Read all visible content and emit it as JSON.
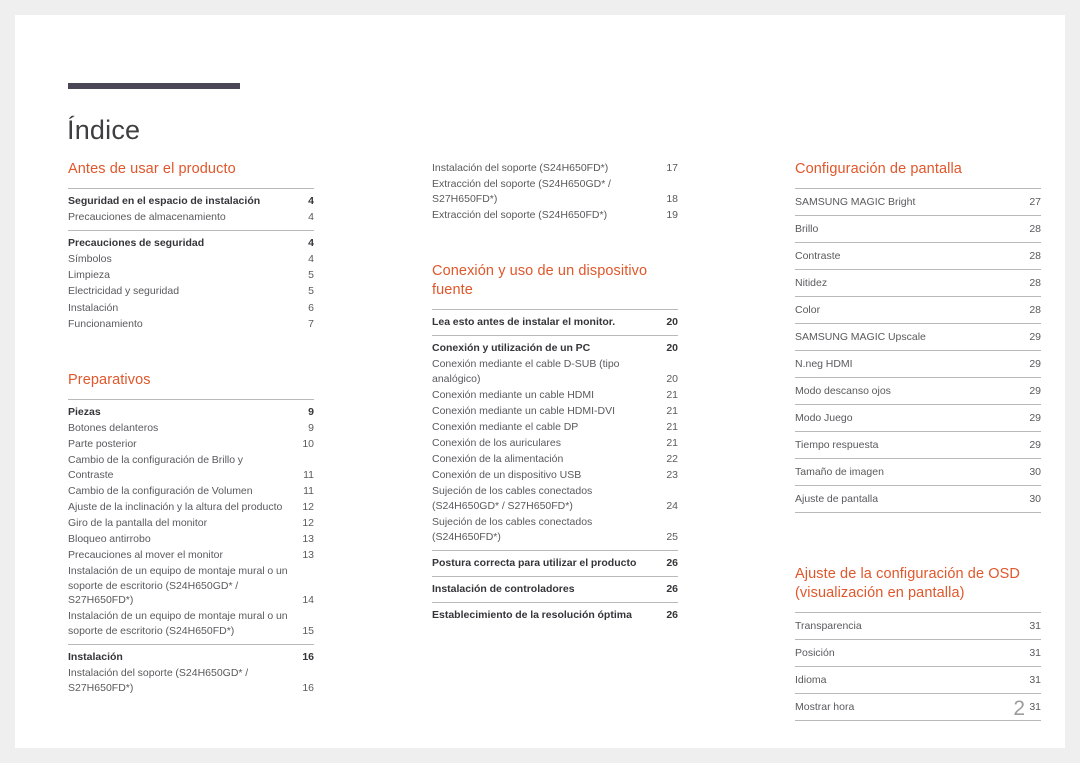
{
  "document": {
    "title": "Índice",
    "folio": "2",
    "accent_color": "#e0572b",
    "rule_color": "#4a4655"
  },
  "columns": [
    {
      "id": "column-1",
      "sections": [
        {
          "heading": "Antes de usar el producto",
          "groups": [
            {
              "entries": [
                {
                  "label": "Seguridad en el espacio de instalación",
                  "page": "4",
                  "bold": true
                },
                {
                  "label": "Precauciones de almacenamiento",
                  "page": "4",
                  "bold": false
                }
              ]
            },
            {
              "entries": [
                {
                  "label": "Precauciones de seguridad",
                  "page": "4",
                  "bold": true
                },
                {
                  "label": "Símbolos",
                  "page": "4",
                  "bold": false
                },
                {
                  "label": "Limpieza",
                  "page": "5",
                  "bold": false
                },
                {
                  "label": "Electricidad y seguridad",
                  "page": "5",
                  "bold": false
                },
                {
                  "label": "Instalación",
                  "page": "6",
                  "bold": false
                },
                {
                  "label": "Funcionamiento",
                  "page": "7",
                  "bold": false
                }
              ]
            }
          ]
        },
        {
          "heading": "Preparativos",
          "groups": [
            {
              "entries": [
                {
                  "label": "Piezas",
                  "page": "9",
                  "bold": true
                },
                {
                  "label": "Botones delanteros",
                  "page": "9",
                  "bold": false
                },
                {
                  "label": "Parte posterior",
                  "page": "10",
                  "bold": false
                },
                {
                  "label": "Cambio de la configuración de Brillo y Contraste",
                  "page": "11",
                  "bold": false
                },
                {
                  "label": "Cambio de la configuración de Volumen",
                  "page": "11",
                  "bold": false
                },
                {
                  "label": "Ajuste de la inclinación y la altura del producto",
                  "page": "12",
                  "bold": false
                },
                {
                  "label": "Giro de la pantalla del monitor",
                  "page": "12",
                  "bold": false
                },
                {
                  "label": "Bloqueo antirrobo",
                  "page": "13",
                  "bold": false
                },
                {
                  "label": "Precauciones al mover el monitor",
                  "page": "13",
                  "bold": false
                },
                {
                  "label": "Instalación de un equipo de montaje mural o un soporte de escritorio (S24H650GD* / S27H650FD*)",
                  "page": "14",
                  "bold": false
                },
                {
                  "label": "Instalación de un equipo de montaje mural o un soporte de escritorio (S24H650FD*)",
                  "page": "15",
                  "bold": false
                }
              ]
            },
            {
              "entries": [
                {
                  "label": "Instalación",
                  "page": "16",
                  "bold": true
                },
                {
                  "label": "Instalación del soporte (S24H650GD* / S27H650FD*)",
                  "page": "16",
                  "bold": false
                }
              ]
            }
          ]
        }
      ]
    },
    {
      "id": "column-2",
      "sections": [
        {
          "heading": "",
          "groups": [
            {
              "entries": [
                {
                  "label": "Instalación del soporte (S24H650FD*)",
                  "page": "17",
                  "bold": false
                },
                {
                  "label": "Extracción del soporte (S24H650GD* / S27H650FD*)",
                  "page": "18",
                  "bold": false
                },
                {
                  "label": "Extracción del soporte (S24H650FD*)",
                  "page": "19",
                  "bold": false
                }
              ]
            }
          ]
        },
        {
          "heading": "Conexión y uso de un dispositivo fuente",
          "groups": [
            {
              "entries": [
                {
                  "label": "Lea esto antes de instalar el monitor.",
                  "page": "20",
                  "bold": true
                }
              ]
            },
            {
              "entries": [
                {
                  "label": "Conexión y utilización de un PC",
                  "page": "20",
                  "bold": true
                },
                {
                  "label": "Conexión mediante el cable D-SUB (tipo analógico)",
                  "page": "20",
                  "bold": false
                },
                {
                  "label": "Conexión mediante un cable HDMI",
                  "page": "21",
                  "bold": false
                },
                {
                  "label": "Conexión mediante un cable HDMI-DVI",
                  "page": "21",
                  "bold": false
                },
                {
                  "label": "Conexión mediante el cable DP",
                  "page": "21",
                  "bold": false
                },
                {
                  "label": "Conexión de los auriculares",
                  "page": "21",
                  "bold": false
                },
                {
                  "label": "Conexión de la alimentación",
                  "page": "22",
                  "bold": false
                },
                {
                  "label": "Conexión de un dispositivo USB",
                  "page": "23",
                  "bold": false
                },
                {
                  "label": "Sujeción de los cables conectados (S24H650GD* / S27H650FD*)",
                  "page": "24",
                  "bold": false
                },
                {
                  "label": "Sujeción de los cables conectados (S24H650FD*)",
                  "page": "25",
                  "bold": false
                }
              ]
            },
            {
              "entries": [
                {
                  "label": "Postura correcta para utilizar el producto",
                  "page": "26",
                  "bold": true
                }
              ]
            },
            {
              "entries": [
                {
                  "label": "Instalación de controladores",
                  "page": "26",
                  "bold": true
                }
              ]
            },
            {
              "entries": [
                {
                  "label": "Establecimiento de la resolución óptima",
                  "page": "26",
                  "bold": true
                }
              ]
            }
          ]
        }
      ]
    },
    {
      "id": "column-3",
      "sections": [
        {
          "heading": "Configuración de pantalla",
          "spaced": true,
          "entries": [
            {
              "label": "SAMSUNG MAGIC Bright",
              "page": "27"
            },
            {
              "label": "Brillo",
              "page": "28"
            },
            {
              "label": "Contraste",
              "page": "28"
            },
            {
              "label": "Nitidez",
              "page": "28"
            },
            {
              "label": "Color",
              "page": "28"
            },
            {
              "label": "SAMSUNG MAGIC Upscale",
              "page": "29"
            },
            {
              "label": "N.neg HDMI",
              "page": "29"
            },
            {
              "label": "Modo descanso ojos",
              "page": "29"
            },
            {
              "label": "Modo Juego",
              "page": "29"
            },
            {
              "label": "Tiempo respuesta",
              "page": "29"
            },
            {
              "label": "Tamaño de imagen",
              "page": "30"
            },
            {
              "label": "Ajuste de pantalla",
              "page": "30"
            }
          ]
        },
        {
          "heading": "Ajuste de la configuración de OSD (visualización en pantalla)",
          "spaced": true,
          "entries": [
            {
              "label": "Transparencia",
              "page": "31"
            },
            {
              "label": "Posición",
              "page": "31"
            },
            {
              "label": "Idioma",
              "page": "31"
            },
            {
              "label": "Mostrar hora",
              "page": "31"
            }
          ]
        }
      ]
    }
  ]
}
